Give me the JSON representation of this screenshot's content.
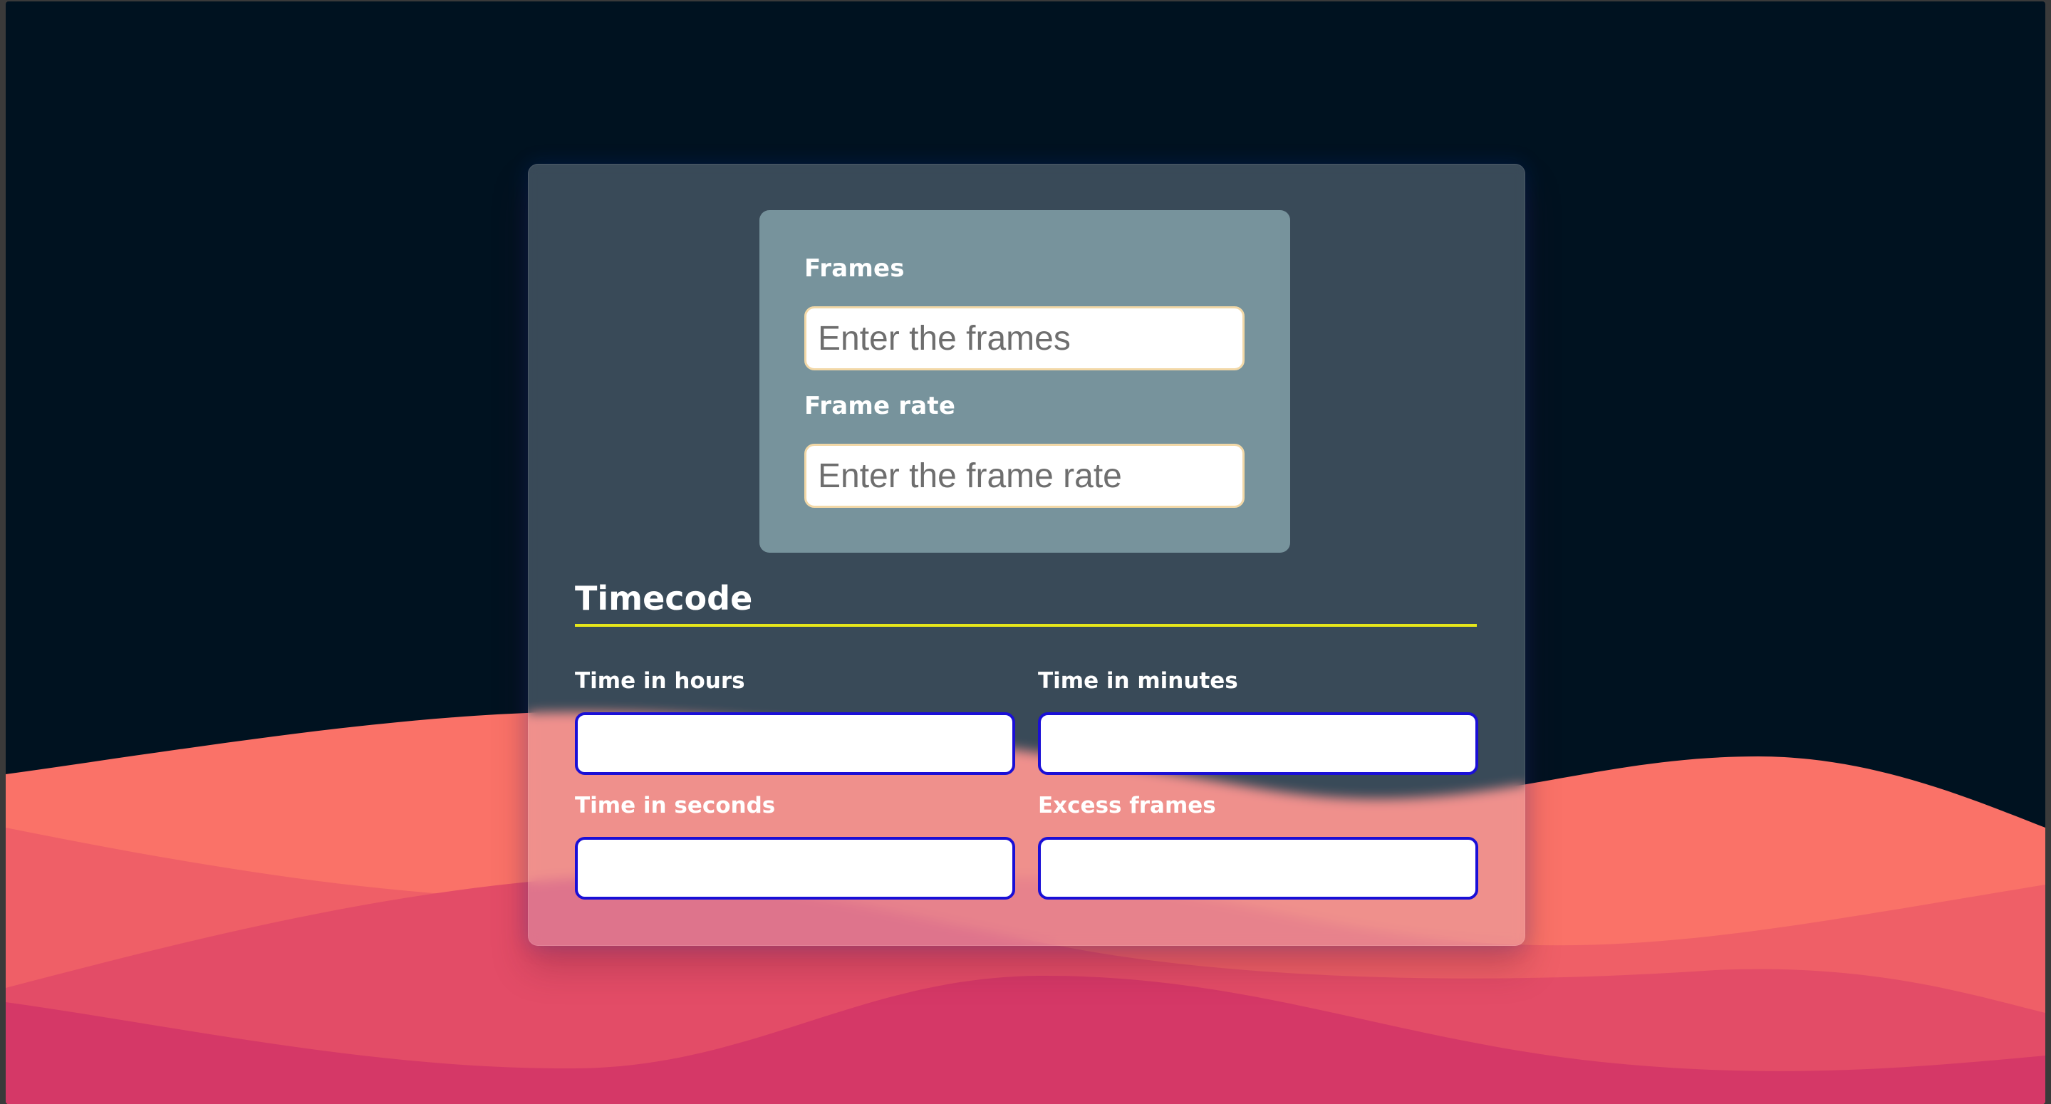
{
  "form": {
    "frames_label": "Frames",
    "frames_placeholder": "Enter the frames",
    "frame_rate_label": "Frame rate",
    "frame_rate_placeholder": "Enter the frame rate"
  },
  "timecode": {
    "title": "Timecode",
    "hours_label": "Time in hours",
    "minutes_label": "Time in minutes",
    "seconds_label": "Time in seconds",
    "excess_frames_label": "Excess frames",
    "hours_value": "",
    "minutes_value": "",
    "seconds_value": "",
    "excess_frames_value": ""
  },
  "colors": {
    "background": "#001220",
    "wave_1": "#FA7268",
    "wave_2": "#EF5F67",
    "wave_3": "#E34C67",
    "wave_4": "#D53867",
    "panel": "#77939C",
    "accent_rule": "#E6E61A",
    "output_border": "#1A0FD6",
    "input_border": "#F2D8A7"
  }
}
